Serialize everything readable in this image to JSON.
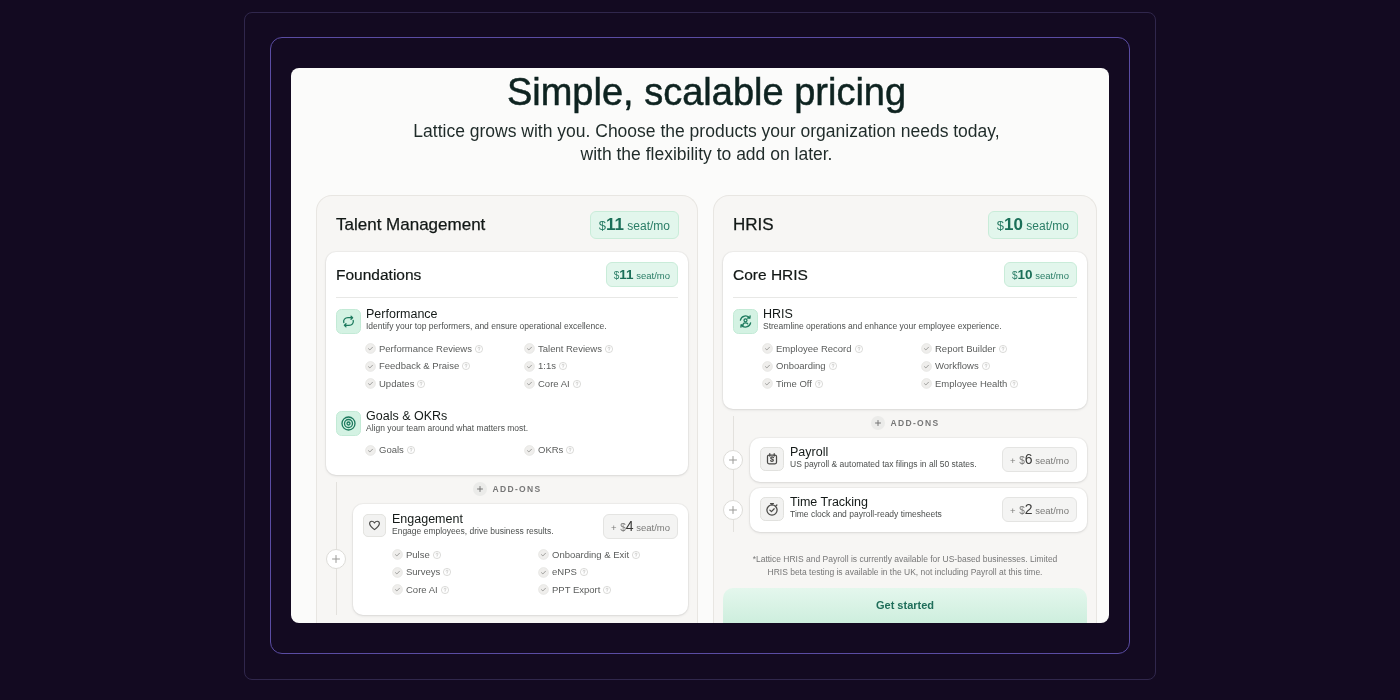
{
  "header": {
    "title": "Simple, scalable pricing",
    "subtitle": "Lattice grows with you. Choose the products your organization needs today, with the flexibility to add on later."
  },
  "plans": [
    {
      "name": "Talent Management",
      "price": {
        "currency": "$",
        "amount": "11",
        "unit": "seat/mo"
      },
      "bundle": {
        "name": "Foundations",
        "price": {
          "currency": "$",
          "amount": "11",
          "unit": "seat/mo"
        },
        "products": [
          {
            "kind": "performance",
            "name": "Performance",
            "description": "Identify your top performers, and ensure operational excellence.",
            "features": [
              "Performance Reviews",
              "Talent Reviews",
              "Feedback & Praise",
              "1:1s",
              "Updates",
              "Core AI"
            ]
          },
          {
            "kind": "goals",
            "name": "Goals & OKRs",
            "description": "Align your team around what matters most.",
            "features": [
              "Goals",
              "OKRs"
            ]
          }
        ]
      },
      "addons_label": "ADD-ONS",
      "addons": [
        {
          "kind": "engagement",
          "name": "Engagement",
          "description": "Engage employees, drive business results.",
          "price": {
            "prefix": "+",
            "currency": "$",
            "amount": "4",
            "unit": "seat/mo"
          },
          "features": [
            "Pulse",
            "Onboarding & Exit",
            "Surveys",
            "eNPS",
            "Core AI",
            "PPT Export"
          ]
        }
      ]
    },
    {
      "name": "HRIS",
      "price": {
        "currency": "$",
        "amount": "10",
        "unit": "seat/mo"
      },
      "bundle": {
        "name": "Core HRIS",
        "price": {
          "currency": "$",
          "amount": "10",
          "unit": "seat/mo"
        },
        "products": [
          {
            "kind": "hris",
            "name": "HRIS",
            "description": "Streamline operations and enhance your employee experience.",
            "features": [
              "Employee Record",
              "Report Builder",
              "Onboarding",
              "Workflows",
              "Time Off",
              "Employee Health"
            ]
          }
        ]
      },
      "addons_label": "ADD-ONS",
      "addons": [
        {
          "kind": "payroll",
          "name": "Payroll",
          "description": "US payroll & automated tax filings in all 50 states.",
          "price": {
            "prefix": "+",
            "currency": "$",
            "amount": "6",
            "unit": "seat/mo"
          }
        },
        {
          "kind": "time",
          "name": "Time Tracking",
          "description": "Time clock and payroll-ready timesheets",
          "price": {
            "prefix": "+",
            "currency": "$",
            "amount": "2",
            "unit": "seat/mo"
          }
        }
      ],
      "footnote": "*Lattice HRIS and Payroll is currently available for US-based businesses. Limited HRIS beta testing is available in the UK, not including Payroll at this time.",
      "cta": "Get started"
    }
  ]
}
